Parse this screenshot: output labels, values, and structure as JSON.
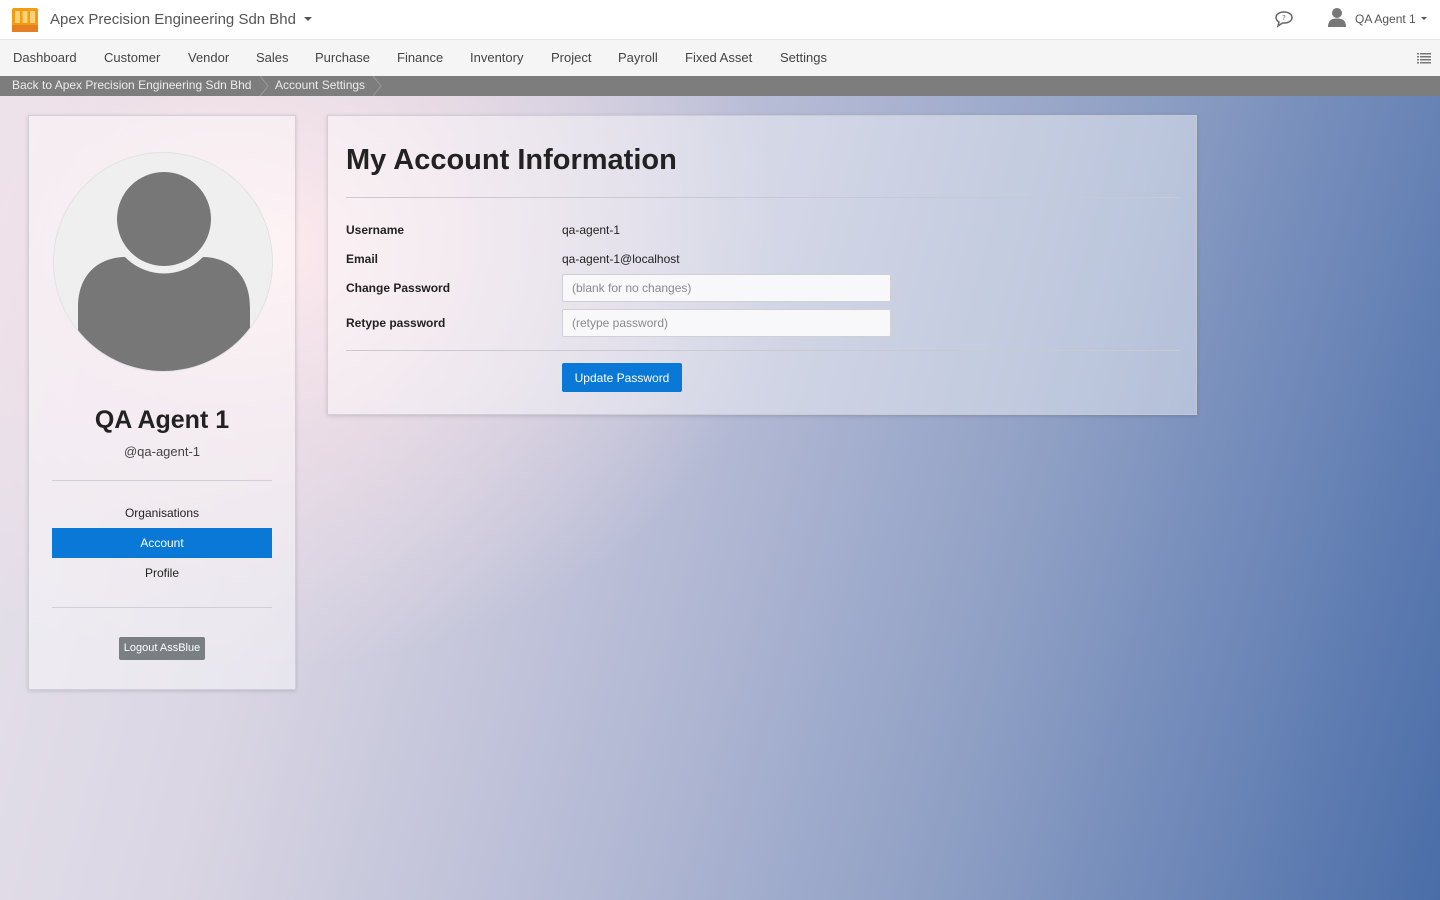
{
  "header": {
    "org_name": "Apex Precision Engineering Sdn Bhd",
    "user_name": "QA Agent 1",
    "icons": [
      "app-logo-icon",
      "caret-down-icon",
      "chat-bubble-icon",
      "user-icon",
      "list-icon"
    ]
  },
  "nav": {
    "items": [
      {
        "label": "Dashboard"
      },
      {
        "label": "Customer"
      },
      {
        "label": "Vendor"
      },
      {
        "label": "Sales"
      },
      {
        "label": "Purchase"
      },
      {
        "label": "Finance"
      },
      {
        "label": "Inventory"
      },
      {
        "label": "Project"
      },
      {
        "label": "Payroll"
      },
      {
        "label": "Fixed Asset"
      },
      {
        "label": "Settings"
      }
    ]
  },
  "breadcrumb": {
    "items": [
      {
        "label": "Back to Apex Precision Engineering Sdn Bhd"
      },
      {
        "label": "Account Settings"
      }
    ]
  },
  "profile": {
    "name": "QA Agent 1",
    "handle": "@qa-agent-1",
    "links": [
      {
        "label": "Organisations",
        "active": false
      },
      {
        "label": "Account",
        "active": true
      },
      {
        "label": "Profile",
        "active": false
      }
    ],
    "logout_label": "Logout AssBlue"
  },
  "account": {
    "title": "My Account Information",
    "username_label": "Username",
    "username_value": "qa-agent-1",
    "email_label": "Email",
    "email_value": "qa-agent-1@localhost",
    "change_password_label": "Change Password",
    "change_password_placeholder": "(blank for no changes)",
    "retype_password_label": "Retype password",
    "retype_password_placeholder": "(retype password)",
    "update_button": "Update Password"
  },
  "colors": {
    "accent": "#0a78d7",
    "logo_orange": "#f39c12",
    "breadcrumb_bg": "#7d7d7d",
    "logout_bg": "#7a7f84"
  }
}
